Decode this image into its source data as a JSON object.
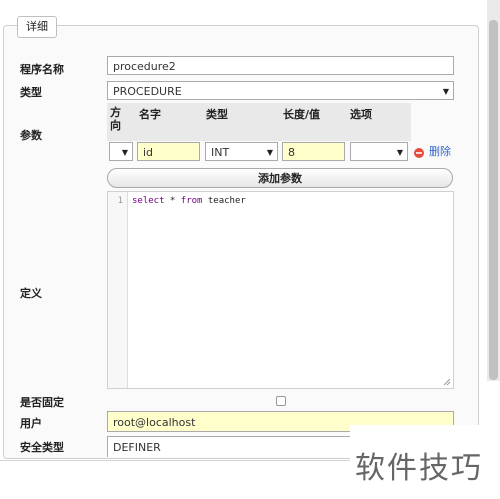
{
  "section": {
    "legend": "详细"
  },
  "form": {
    "routine_name": {
      "label": "程序名称",
      "value": "procedure2"
    },
    "type": {
      "label": "类型",
      "value": "PROCEDURE"
    },
    "params": {
      "label": "参数",
      "headers": {
        "direction": "方向",
        "name": "名字",
        "type": "类型",
        "length": "长度/值",
        "options": "选项"
      },
      "rows": [
        {
          "direction": "",
          "name": "id",
          "type": "INT",
          "length": "8",
          "options": "",
          "delete_label": "删除"
        }
      ],
      "add_label": "添加参数"
    },
    "definition": {
      "label": "定义",
      "line_number": "1",
      "code_kw1": "select",
      "code_mid": " * ",
      "code_kw2": "from",
      "code_end": " teacher"
    },
    "deterministic": {
      "label": "是否固定",
      "checked": false
    },
    "definer": {
      "label": "用户",
      "value": "root@localhost"
    },
    "security": {
      "label": "安全类型",
      "value": "DEFINER"
    }
  },
  "watermark": {
    "text": "软件技巧"
  },
  "colors": {
    "highlight": "#ffffcc",
    "delete_icon": "#e84a3c",
    "link": "#3366cc"
  },
  "icons": {
    "delete": "minus-circle-icon",
    "dropdown": "caret-down-icon"
  }
}
